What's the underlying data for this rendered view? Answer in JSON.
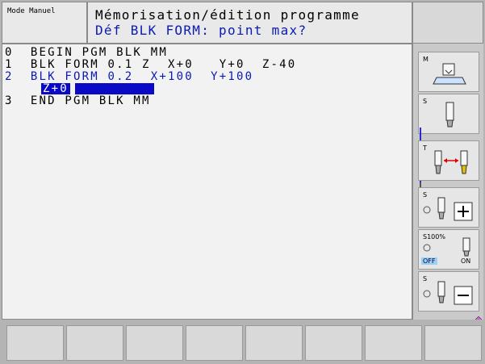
{
  "header": {
    "mode_label": "Mode Manuel",
    "title_line1": "Mémorisation/édition programme",
    "title_line2": "Déf BLK FORM: point max?"
  },
  "program": {
    "lines": [
      "0  BEGIN PGM BLK MM",
      "1  BLK FORM 0.1 Z  X+0   Y+0  Z-40",
      "2  BLK FORM 0.2  X+100  Y+100",
      "3  END PGM BLK MM"
    ],
    "edit_value": "Z+0"
  },
  "softkeys_right": [
    {
      "label": "M",
      "icon": "spindle-m-icon"
    },
    {
      "label": "S",
      "icon": "tool-s-icon"
    },
    {
      "label": "T",
      "icon": "tool-change-icon"
    },
    {
      "label": "S",
      "icon": "spindle-plus-icon"
    },
    {
      "label": "S100%",
      "icon": "spindle-override-icon",
      "off": "OFF",
      "on": "ON"
    },
    {
      "label": "S",
      "icon": "spindle-minus-icon"
    }
  ],
  "colors": {
    "accent_blue": "#0b1ab3",
    "highlight": "#0a0ac6"
  }
}
